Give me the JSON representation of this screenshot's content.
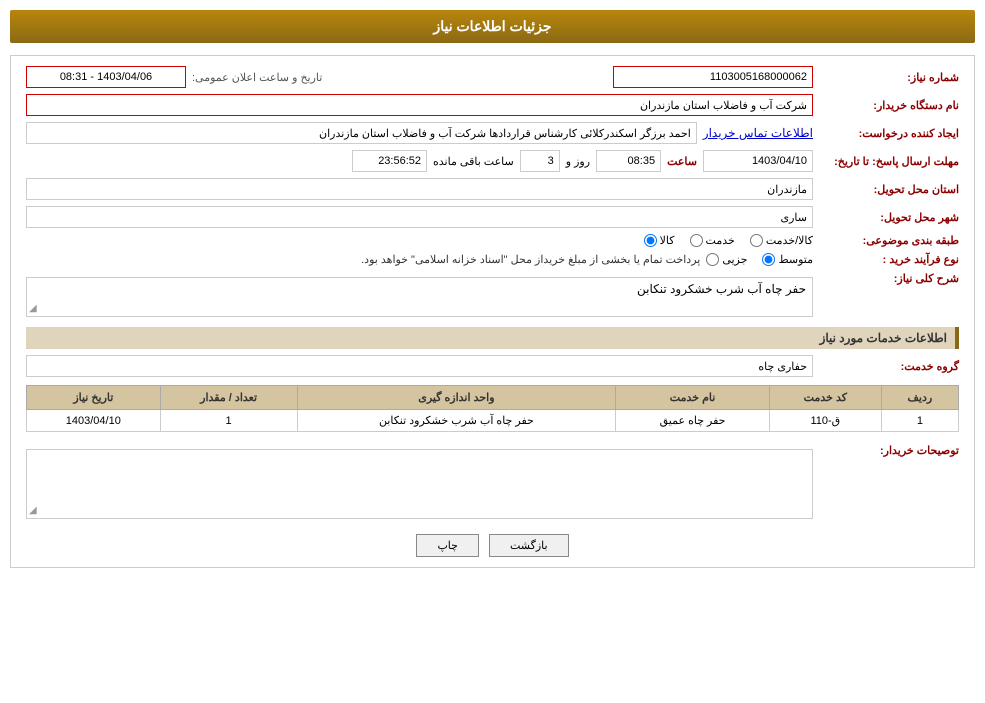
{
  "page": {
    "title": "جزئیات اطلاعات نیاز"
  },
  "header": {
    "need_number_label": "شماره نیاز:",
    "need_number_value": "1103005168000062",
    "announce_date_label": "تاریخ و ساعت اعلان عمومی:",
    "announce_date_value": "1403/04/06 - 08:31",
    "buyer_org_label": "نام دستگاه خریدار:",
    "buyer_org_value": "شرکت آب و فاضلاب استان مازندران",
    "creator_label": "ایجاد کننده درخواست:",
    "creator_name": "احمد برزگر اسکندرکلائی کارشناس قراردادها شرکت آب و فاضلاب استان مازندران",
    "creator_link": "اطلاعات تماس خریدار",
    "deadline_label": "مهلت ارسال پاسخ: تا تاریخ:",
    "deadline_date": "1403/04/10",
    "deadline_time_label": "ساعت",
    "deadline_time": "08:35",
    "deadline_day_label": "روز و",
    "deadline_days": "3",
    "deadline_remaining_label": "ساعت باقی مانده",
    "deadline_remaining": "23:56:52",
    "province_label": "استان محل تحویل:",
    "province_value": "مازندران",
    "city_label": "شهر محل تحویل:",
    "city_value": "ساری",
    "category_label": "طبقه بندی موضوعی:",
    "category_options": [
      {
        "label": "کالا",
        "value": "kala",
        "selected": true
      },
      {
        "label": "خدمت",
        "value": "khadamat",
        "selected": false
      },
      {
        "label": "کالا/خدمت",
        "value": "kala_khadamat",
        "selected": false
      }
    ],
    "purchase_type_label": "نوع فرآیند خرید :",
    "purchase_type_options": [
      {
        "label": "جزیی",
        "value": "jozee",
        "selected": false
      },
      {
        "label": "متوسط",
        "value": "mottavaset",
        "selected": true
      }
    ],
    "purchase_note": "پرداخت تمام یا بخشی از مبلغ خریداز محل \"اسناد خزانه اسلامی\" خواهد بود.",
    "need_description_label": "شرح کلی نیاز:",
    "need_description_value": "حفر چاه آب شرب خشکرود تنکابن"
  },
  "services_section": {
    "title": "اطلاعات خدمات مورد نیاز",
    "service_group_label": "گروه خدمت:",
    "service_group_value": "حفاری چاه",
    "table": {
      "columns": [
        {
          "label": "ردیف",
          "key": "row"
        },
        {
          "label": "کد خدمت",
          "key": "code"
        },
        {
          "label": "نام خدمت",
          "key": "name"
        },
        {
          "label": "واحد اندازه گیری",
          "key": "unit"
        },
        {
          "label": "تعداد / مقدار",
          "key": "quantity"
        },
        {
          "label": "تاریخ نیاز",
          "key": "date"
        }
      ],
      "rows": [
        {
          "row": "1",
          "code": "ق-110",
          "name": "حفر چاه عمیق",
          "unit": "حفر چاه آب شرب خشکرود تنکابن",
          "quantity": "1",
          "date": "1403/04/10"
        }
      ]
    }
  },
  "buyer_notes_label": "توصیحات خریدار:",
  "buttons": {
    "print_label": "چاپ",
    "back_label": "بازگشت"
  }
}
